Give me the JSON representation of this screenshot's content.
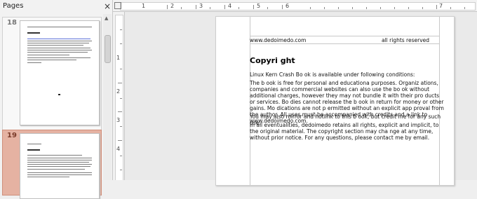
{
  "pages_pane": {
    "title": "Pages",
    "close_glyph": "×",
    "pages": [
      {
        "number": "18",
        "selected": false,
        "thumb_title": "Kh ndt"
      },
      {
        "number": "19",
        "selected": true,
        "thumb_title": "Copyri ght"
      }
    ]
  },
  "ruler": {
    "h_numbers": [
      "1",
      "2",
      "3",
      "4",
      "5",
      "6",
      "7"
    ],
    "v_numbers": [
      "1",
      "2",
      "3",
      "4"
    ]
  },
  "document": {
    "header_left": "www.dedoimedo.com",
    "header_right": "all rights reserved",
    "title": "Copyri ght",
    "para1": "Linux Kern Crash Bo ok is available under following conditions:",
    "para2": "The b ook is free for personal and educationa purposes. Organiz ations, companies and commercial websites can also use the bo ok without additional charges, however they may not bundle it with their pro ducts or services. Bo dies cannot release the b ook in return for money or other gains. Mo dications are not p ermitted without an explicit app proval from the author. All uses must be accompanied with credits and a link to www.dedoimedo.com.",
    "para3": "You may also mirror and hotlink to this b ook, but credit me for any such use.",
    "para4": "In all eventualities, dedoimedo retains all rights, explicit and implicit, to the original material. The copyright section may cha nge at any time, without prior notice. For any questions, please contact me by email."
  }
}
